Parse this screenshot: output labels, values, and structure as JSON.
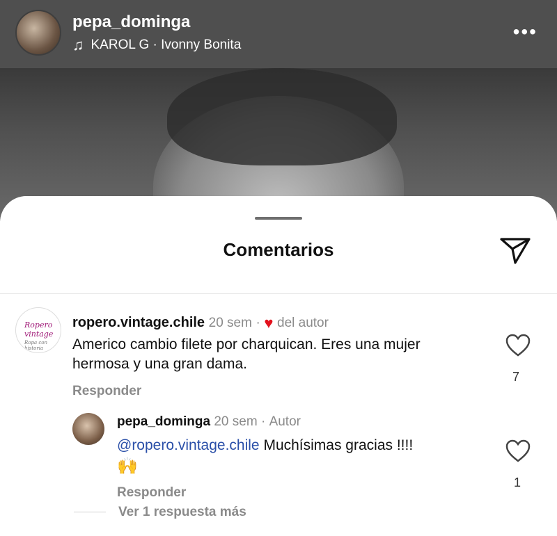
{
  "header": {
    "username": "pepa_dominga",
    "song": "KAROL G · Ivonny Bonita"
  },
  "sheet": {
    "title": "Comentarios"
  },
  "comment": {
    "username": "ropero.vintage.chile",
    "time": "20 sem",
    "author_like_label": "del autor",
    "text": "Americo cambio filete por charquican. Eres una mujer hermosa y una gran dama.",
    "likes": "7",
    "reply_label": "Responder",
    "avatar_logo": "Ropero vintage",
    "avatar_logo_sub": "Ropa con historia"
  },
  "reply": {
    "username": "pepa_dominga",
    "time": "20 sem",
    "badge": "Autor",
    "mention": "@ropero.vintage.chile",
    "text": "Muchísimas gracias !!!!",
    "emoji": "🙌",
    "likes": "1",
    "reply_label": "Responder"
  },
  "more_replies": "Ver 1 respuesta más",
  "colors": {
    "header_bg": "#4f4f4f",
    "mention": "#2a4fa8",
    "heart_red": "#e3121d"
  }
}
